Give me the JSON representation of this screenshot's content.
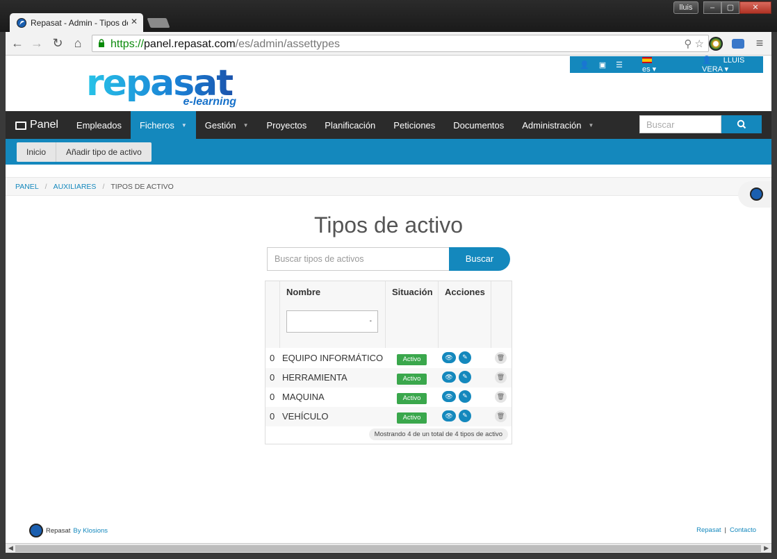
{
  "window": {
    "tab_title": "Repasat - Admin - Tipos de activo",
    "user_badge": "lluis",
    "min": "–",
    "max": "▢",
    "close": "✕"
  },
  "toolbar": {
    "url_scheme": "https://",
    "url_host": "panel.repasat.com",
    "url_path": "/es/admin/assettypes",
    "back_icon": "←",
    "forward_icon": "→",
    "reload_icon": "↻",
    "home_icon": "⌂",
    "menu_icon": "≡",
    "zoom_icon": "⚲",
    "star_icon": "☆"
  },
  "userbar": {
    "lang": "es",
    "user": "LLUIS VERA"
  },
  "logo": {
    "main": "repasat",
    "sub": "e-learning"
  },
  "mainnav": {
    "brand": "Panel",
    "items": [
      {
        "label": "Empleados",
        "caret": false,
        "active": false
      },
      {
        "label": "Ficheros",
        "caret": true,
        "active": true
      },
      {
        "label": "Gestión",
        "caret": true,
        "active": false
      },
      {
        "label": "Proyectos",
        "caret": false,
        "active": false
      },
      {
        "label": "Planificación",
        "caret": false,
        "active": false
      },
      {
        "label": "Peticiones",
        "caret": false,
        "active": false
      },
      {
        "label": "Documentos",
        "caret": false,
        "active": false
      },
      {
        "label": "Administración",
        "caret": true,
        "active": false
      }
    ],
    "search_placeholder": "Buscar"
  },
  "subnav": {
    "home": "Inicio",
    "add": "Añadir tipo de activo"
  },
  "breadcrumb": {
    "items": [
      "PANEL",
      "AUXILIARES",
      "TIPOS DE ACTIVO"
    ]
  },
  "main": {
    "title": "Tipos de activo",
    "search_placeholder": "Buscar tipos de activos",
    "search_button": "Buscar"
  },
  "grid": {
    "headers": {
      "name": "Nombre",
      "status": "Situación",
      "actions": "Acciones"
    },
    "filter_value": "-",
    "rows": [
      {
        "count": "0",
        "name": "EQUIPO INFORMÁTICO",
        "status": "Activo"
      },
      {
        "count": "0",
        "name": "HERRAMIENTA",
        "status": "Activo"
      },
      {
        "count": "0",
        "name": "MAQUINA",
        "status": "Activo"
      },
      {
        "count": "0",
        "name": "VEHÍCULO",
        "status": "Activo"
      }
    ],
    "footer": "Mostrando 4 de un total de 4 tipos de activo"
  },
  "footer": {
    "brand": "Repasat",
    "by": "By Klosions",
    "link1": "Repasat",
    "link2": "Contacto"
  },
  "colors": {
    "accent": "#1488bd",
    "nav_dark": "#2b2b2b",
    "status_green": "#3aa74c"
  }
}
